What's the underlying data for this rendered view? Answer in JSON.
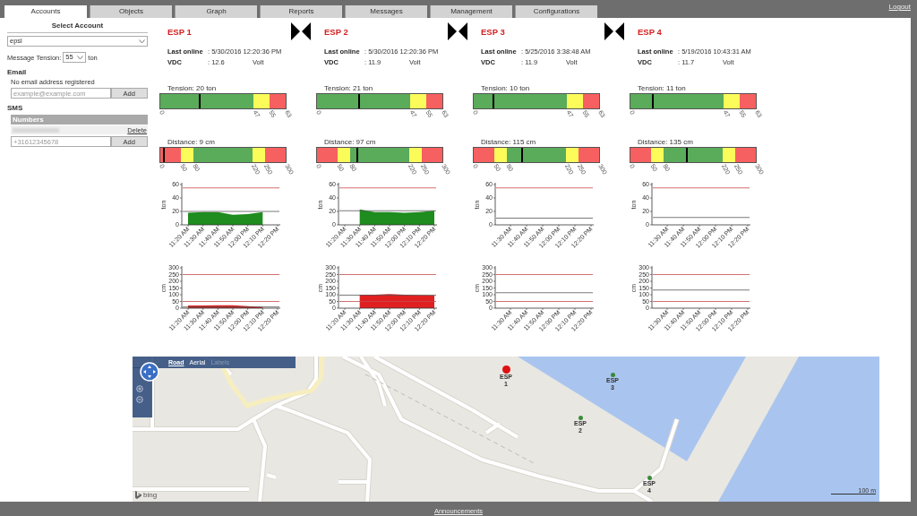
{
  "tabs": [
    {
      "label": "Accounts",
      "selected": true
    },
    {
      "label": "Objects",
      "selected": false
    },
    {
      "label": "Graph",
      "selected": false
    },
    {
      "label": "Reports",
      "selected": false
    },
    {
      "label": "Messages",
      "selected": false
    },
    {
      "label": "Management",
      "selected": false
    },
    {
      "label": "Configurations",
      "selected": false
    }
  ],
  "logout": "Logout",
  "account_panel": {
    "heading": "Select Account",
    "account": "epsl",
    "tension_label": "Message Tension:",
    "tension_value": "55",
    "tension_unit": "ton",
    "email_heading": "Email",
    "email_note": "No email address registered",
    "email_placeholder": "example@example.com",
    "email_button": "Add",
    "sms_heading": "SMS",
    "numbers_header": "Numbers",
    "numbers": [
      {
        "action": "Delete"
      }
    ],
    "phone_placeholder": "+31612345678",
    "phone_button": "Add"
  },
  "stations": [
    {
      "title": "ESP 1",
      "last_online_label": "Last online",
      "last_online": ": 5/30/2016 12:20:36 PM",
      "vdc_label": "VDC",
      "vdc": ": 12.6",
      "vdc_unit": "Volt",
      "tension": {
        "label": "Tension: 20 ton",
        "level": 0.317,
        "ticks": [
          "0",
          "47",
          "55",
          "63"
        ],
        "zones": [
          {
            "color": "#5aab5a"
          },
          {
            "color": "#fbfb5a"
          },
          {
            "color": "#f76060"
          }
        ]
      },
      "distance": {
        "label": "Distance: 9 cm",
        "level": 0.03,
        "ticks": [
          "0",
          "50",
          "80",
          "220",
          "250",
          "300"
        ],
        "zones": [
          {
            "color": "#f76060"
          },
          {
            "color": "#fbfb5a"
          },
          {
            "color": "#5aab5a"
          },
          {
            "color": "#fbfb5a"
          },
          {
            "color": "#f76060"
          }
        ]
      },
      "tension_chart": {
        "chart_data": {
          "type": "area",
          "ylabel": "ton",
          "categories": [
            "11:20 AM",
            "11:30 AM",
            "11:40 AM",
            "11:50 AM",
            "12:00 PM",
            "12:10 PM",
            "12:20 PM"
          ],
          "ylim": [
            0,
            60
          ],
          "yticks": [
            0,
            20,
            40,
            60
          ],
          "series": [
            {
              "color": "#1e8c1e",
              "values": [
                18,
                19,
                19,
                15,
                16,
                19,
                null
              ]
            }
          ],
          "ref_lines": [
            {
              "axis": "y",
              "value": 55,
              "color": "#c84a4a"
            },
            {
              "axis": "y",
              "value": 20,
              "color": "#555555"
            }
          ]
        }
      },
      "distance_chart": {
        "chart_data": {
          "type": "area",
          "ylabel": "cm",
          "categories": [
            "11:20 AM",
            "11:30 AM",
            "11:40 AM",
            "11:50 AM",
            "12:00 PM",
            "12:10 PM",
            "12:20 PM"
          ],
          "ylim": [
            0,
            300
          ],
          "yticks": [
            0,
            50,
            100,
            150,
            200,
            250,
            300
          ],
          "series": [
            {
              "color": "#e02020",
              "values": [
                20,
                20,
                22,
                22,
                15,
                8,
                null
              ]
            }
          ],
          "ref_lines": [
            {
              "axis": "y",
              "value": 250,
              "color": "#c84a4a"
            },
            {
              "axis": "y",
              "value": 50,
              "color": "#c84a4a"
            },
            {
              "axis": "y",
              "value": 9,
              "color": "#555555"
            }
          ]
        }
      }
    },
    {
      "title": "ESP 2",
      "last_online_label": "Last online",
      "last_online": ": 5/30/2016 12:20:36 PM",
      "vdc_label": "VDC",
      "vdc": ": 11.9",
      "vdc_unit": "Volt",
      "tension": {
        "label": "Tension: 21 ton",
        "level": 0.333,
        "ticks": [
          "0",
          "47",
          "55",
          "63"
        ],
        "zones": [
          {
            "color": "#5aab5a"
          },
          {
            "color": "#fbfb5a"
          },
          {
            "color": "#f76060"
          }
        ]
      },
      "distance": {
        "label": "Distance: 97 cm",
        "level": 0.323,
        "ticks": [
          "0",
          "50",
          "80",
          "220",
          "250",
          "300"
        ],
        "zones": [
          {
            "color": "#f76060"
          },
          {
            "color": "#fbfb5a"
          },
          {
            "color": "#5aab5a"
          },
          {
            "color": "#fbfb5a"
          },
          {
            "color": "#f76060"
          }
        ]
      },
      "tension_chart": {
        "chart_data": {
          "type": "area",
          "ylabel": "ton",
          "categories": [
            "11:20 AM",
            "11:30 AM",
            "11:40 AM",
            "11:50 AM",
            "12:00 PM",
            "12:10 PM",
            "12:20 PM"
          ],
          "ylim": [
            0,
            60
          ],
          "yticks": [
            0,
            20,
            40,
            60
          ],
          "series": [
            {
              "color": "#1e8c1e",
              "values": [
                null,
                23,
                19,
                19,
                18,
                19,
                21
              ]
            }
          ],
          "ref_lines": [
            {
              "axis": "y",
              "value": 55,
              "color": "#c84a4a"
            },
            {
              "axis": "y",
              "value": 21,
              "color": "#555555"
            }
          ]
        }
      },
      "distance_chart": {
        "chart_data": {
          "type": "area",
          "ylabel": "cm",
          "categories": [
            "11:20 AM",
            "11:30 AM",
            "11:40 AM",
            "11:50 AM",
            "12:00 PM",
            "12:10 PM",
            "12:20 PM"
          ],
          "ylim": [
            0,
            300
          ],
          "yticks": [
            0,
            50,
            100,
            150,
            200,
            250,
            300
          ],
          "series": [
            {
              "color": "#e02020",
              "values": [
                null,
                100,
                100,
                105,
                100,
                97,
                95
              ]
            }
          ],
          "ref_lines": [
            {
              "axis": "y",
              "value": 250,
              "color": "#c84a4a"
            },
            {
              "axis": "y",
              "value": 50,
              "color": "#c84a4a"
            },
            {
              "axis": "y",
              "value": 97,
              "color": "#555555"
            }
          ]
        }
      }
    },
    {
      "title": "ESP 3",
      "last_online_label": "Last online",
      "last_online": ": 5/25/2016 3:38:48 AM",
      "vdc_label": "VDC",
      "vdc": ": 11.9",
      "vdc_unit": "Volt",
      "tension": {
        "label": "Tension: 10 ton",
        "level": 0.159,
        "ticks": [
          "0",
          "47",
          "55",
          "63"
        ],
        "zones": [
          {
            "color": "#5aab5a"
          },
          {
            "color": "#fbfb5a"
          },
          {
            "color": "#f76060"
          }
        ]
      },
      "distance": {
        "label": "Distance: 115 cm",
        "level": 0.383,
        "ticks": [
          "0",
          "50",
          "80",
          "220",
          "250",
          "300"
        ],
        "zones": [
          {
            "color": "#f76060"
          },
          {
            "color": "#fbfb5a"
          },
          {
            "color": "#5aab5a"
          },
          {
            "color": "#fbfb5a"
          },
          {
            "color": "#f76060"
          }
        ]
      },
      "tension_chart": {
        "chart_data": {
          "type": "area",
          "ylabel": "ton",
          "categories": [
            "11:30 AM",
            "11:40 AM",
            "11:50 AM",
            "12:00 PM",
            "12:10 PM",
            "12:20 PM"
          ],
          "ylim": [
            0,
            60
          ],
          "yticks": [
            0,
            20,
            40,
            60
          ],
          "ref_lines": [
            {
              "axis": "y",
              "value": 55,
              "color": "#c84a4a"
            },
            {
              "axis": "y",
              "value": 10,
              "color": "#555555"
            }
          ]
        }
      },
      "distance_chart": {
        "chart_data": {
          "type": "area",
          "ylabel": "cm",
          "categories": [
            "11:30 AM",
            "11:40 AM",
            "11:50 AM",
            "12:00 PM",
            "12:10 PM",
            "12:20 PM"
          ],
          "ylim": [
            0,
            300
          ],
          "yticks": [
            0,
            50,
            100,
            150,
            200,
            250,
            300
          ],
          "ref_lines": [
            {
              "axis": "y",
              "value": 250,
              "color": "#c84a4a"
            },
            {
              "axis": "y",
              "value": 50,
              "color": "#c84a4a"
            },
            {
              "axis": "y",
              "value": 115,
              "color": "#555555"
            }
          ]
        }
      }
    },
    {
      "title": "ESP 4",
      "last_online_label": "Last online",
      "last_online": ": 5/19/2016 10:43:31 AM",
      "vdc_label": "VDC",
      "vdc": ": 11.7",
      "vdc_unit": "Volt",
      "tension": {
        "label": "Tension: 11 ton",
        "level": 0.175,
        "ticks": [
          "0",
          "47",
          "55",
          "63"
        ],
        "zones": [
          {
            "color": "#5aab5a"
          },
          {
            "color": "#fbfb5a"
          },
          {
            "color": "#f76060"
          }
        ]
      },
      "distance": {
        "label": "Distance: 135 cm",
        "level": 0.45,
        "ticks": [
          "0",
          "50",
          "80",
          "220",
          "250",
          "300"
        ],
        "zones": [
          {
            "color": "#f76060"
          },
          {
            "color": "#fbfb5a"
          },
          {
            "color": "#5aab5a"
          },
          {
            "color": "#fbfb5a"
          },
          {
            "color": "#f76060"
          }
        ]
      },
      "tension_chart": {
        "chart_data": {
          "type": "area",
          "ylabel": "ton",
          "categories": [
            "11:30 AM",
            "11:40 AM",
            "11:50 AM",
            "12:00 PM",
            "12:10 PM",
            "12:20 PM"
          ],
          "ylim": [
            0,
            60
          ],
          "yticks": [
            0,
            20,
            40,
            60
          ],
          "ref_lines": [
            {
              "axis": "y",
              "value": 55,
              "color": "#c84a4a"
            },
            {
              "axis": "y",
              "value": 11,
              "color": "#555555"
            }
          ]
        }
      },
      "distance_chart": {
        "chart_data": {
          "type": "area",
          "ylabel": "cm",
          "categories": [
            "11:30 AM",
            "11:40 AM",
            "11:50 AM",
            "12:00 PM",
            "12:10 PM",
            "12:20 PM"
          ],
          "ylim": [
            0,
            300
          ],
          "yticks": [
            0,
            50,
            100,
            150,
            200,
            250,
            300
          ],
          "ref_lines": [
            {
              "axis": "y",
              "value": 250,
              "color": "#c84a4a"
            },
            {
              "axis": "y",
              "value": 50,
              "color": "#c84a4a"
            },
            {
              "axis": "y",
              "value": 135,
              "color": "#555555"
            }
          ]
        }
      }
    }
  ],
  "map": {
    "map_type_options": [
      {
        "label": "Road",
        "selected": true,
        "disabled": false
      },
      {
        "label": "Aerial",
        "selected": false,
        "disabled": false
      },
      {
        "label": "Labels",
        "selected": false,
        "disabled": true
      }
    ],
    "markers": [
      {
        "label": "ESP 1",
        "color": "#dd1111"
      },
      {
        "label": "ESP 2",
        "color": "#3a8a3a"
      },
      {
        "label": "ESP 3",
        "color": "#3a8a3a"
      },
      {
        "label": "ESP 4",
        "color": "#3a8a3a"
      }
    ],
    "scale": "100 m",
    "logo": "bing"
  },
  "footer": {
    "link": "Announcements"
  }
}
